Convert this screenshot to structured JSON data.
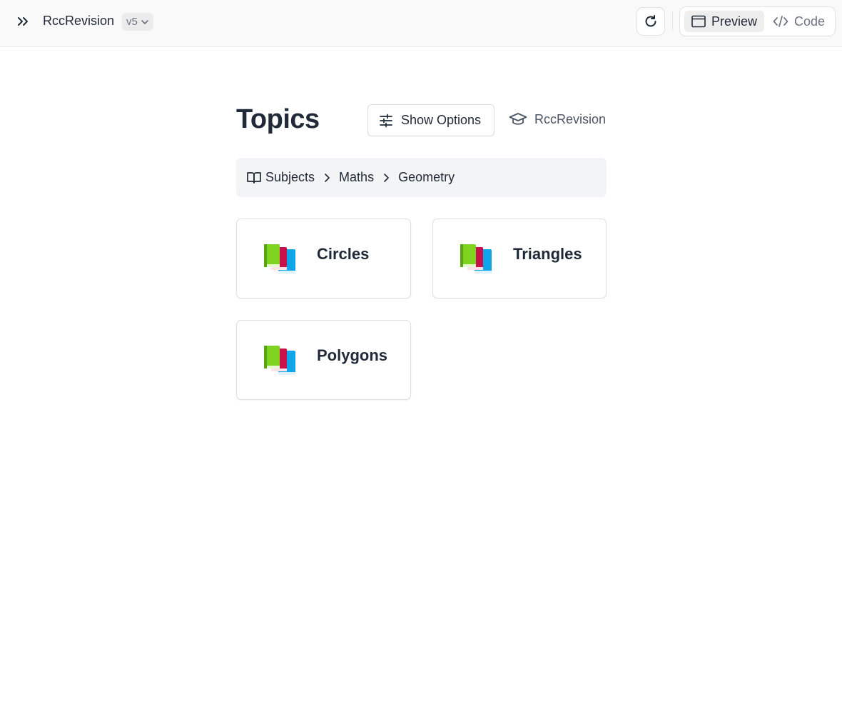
{
  "topbar": {
    "app_name": "RccRevision",
    "version": "v5",
    "preview_label": "Preview",
    "code_label": "Code"
  },
  "header": {
    "title": "Topics",
    "options_label": "Show Options",
    "brand_label": "RccRevision"
  },
  "breadcrumb": {
    "items": [
      "Subjects",
      "Maths",
      "Geometry"
    ]
  },
  "topics": [
    {
      "label": "Circles",
      "icon": "books-icon"
    },
    {
      "label": "Triangles",
      "icon": "books-icon"
    },
    {
      "label": "Polygons",
      "icon": "books-icon"
    }
  ],
  "colors": {
    "book_green": "#7ed321",
    "book_red": "#c8104a",
    "book_blue": "#0ea5e9",
    "text": "#1f2937",
    "muted": "#6b7280"
  }
}
